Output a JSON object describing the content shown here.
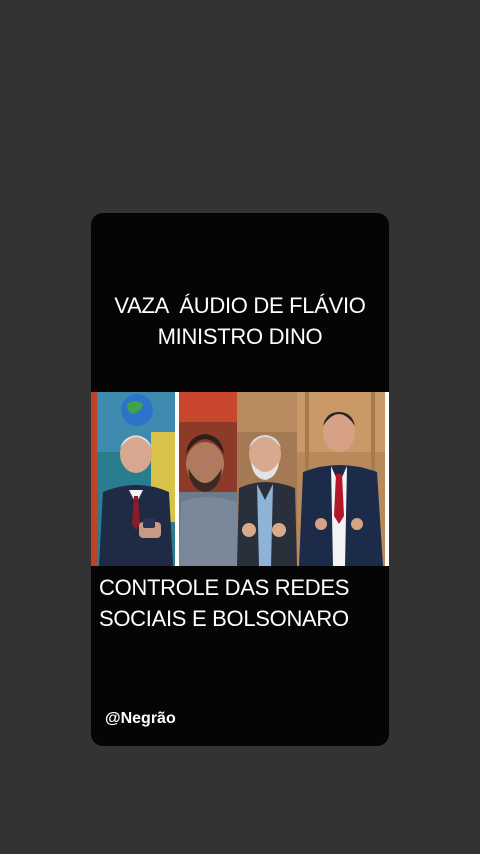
{
  "post": {
    "headline_top": [
      "VAZA  ÁUDIO DE FLÁVIO",
      "MINISTRO DINO"
    ],
    "headline_bottom": [
      "CONTROLE DAS REDES",
      "SOCIAIS E BOLSONARO"
    ],
    "handle": "@Negrão"
  },
  "photo_strip": {
    "panels": [
      "man-with-globe",
      "bearded-man",
      "man-thumbs-up",
      "man-in-suit"
    ]
  },
  "colors": {
    "background": "#333333",
    "card": "#050505",
    "text": "#ffffff"
  }
}
